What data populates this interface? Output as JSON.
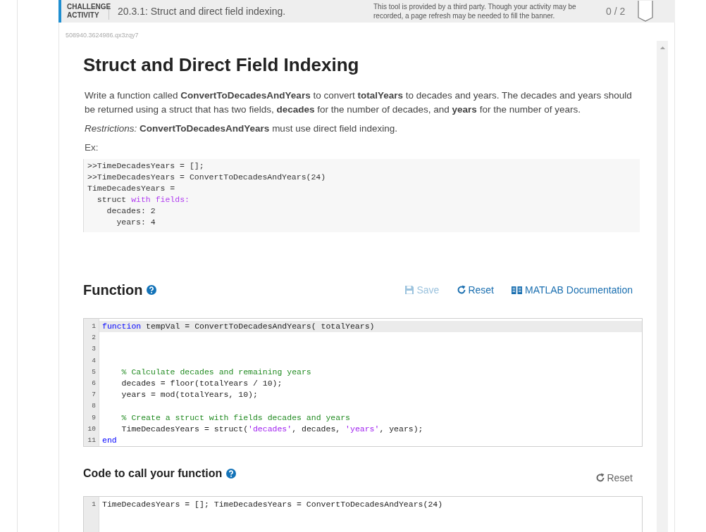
{
  "banner": {
    "label_lines": [
      "CHALLENGE",
      "ACTIVITY"
    ],
    "title": "20.3.1: Struct and direct field indexing.",
    "notice_lines": [
      "This tool is provided by a third party. Though your activity may be",
      "recorded, a page refresh may be needed to fill the banner."
    ],
    "score": "0 / 2"
  },
  "activity_id": "508940.3624986.qx3zqy7",
  "heading": "Struct and Direct Field Indexing",
  "description": "Write a function called **ConvertToDecadesAndYears** to convert **totalYears** to decades and years. The decades and years should be returned using a struct that has two fields, **decades** for the number of decades, and **years** for the number of years.",
  "restrictions": "*Restrictions:* **ConvertToDecadesAndYears** must use direct field indexing.",
  "example_label": "Ex:",
  "example_lines": [
    [
      {
        "kind": "plain",
        "text": ">>TimeDecadesYears = [];"
      }
    ],
    [
      {
        "kind": "plain",
        "text": ">>TimeDecadesYears = ConvertToDecadesAndYears(24)"
      }
    ],
    [
      {
        "kind": "plain",
        "text": "TimeDecadesYears = "
      }
    ],
    [
      {
        "kind": "plain",
        "text": "  struct "
      },
      {
        "kind": "keyword",
        "text": "with fields:"
      }
    ],
    [
      {
        "kind": "plain",
        "text": "    decades: 2"
      }
    ],
    [
      {
        "kind": "plain",
        "text": "      years: 4"
      }
    ]
  ],
  "function_section": {
    "title": "Function",
    "buttons": [
      {
        "kind": "save",
        "label": "Save",
        "disabled": true
      },
      {
        "kind": "reset",
        "label": "Reset",
        "disabled": false
      },
      {
        "kind": "docs",
        "label": "MATLAB Documentation",
        "disabled": false
      }
    ],
    "editor": {
      "lines": [
        {
          "number": "1",
          "active": true,
          "segments": [
            {
              "kind": "keyword",
              "text": "function"
            },
            {
              "kind": "plain",
              "text": " tempVal = ConvertToDecadesAndYears( totalYears)"
            }
          ]
        },
        {
          "number": "2",
          "active": false
        },
        {
          "number": "3",
          "active": false
        },
        {
          "number": "4",
          "active": false
        },
        {
          "number": "5",
          "active": false,
          "segments": [
            {
              "kind": "comment",
              "text": "    % Calculate decades and remaining years"
            }
          ]
        },
        {
          "number": "6",
          "active": false,
          "segments": [
            {
              "kind": "plain",
              "text": "    decades = floor(totalYears / 10);"
            }
          ]
        },
        {
          "number": "7",
          "active": false,
          "segments": [
            {
              "kind": "plain",
              "text": "    years = mod(totalYears, 10);"
            }
          ]
        },
        {
          "number": "8",
          "active": false
        },
        {
          "number": "9",
          "active": false,
          "segments": [
            {
              "kind": "comment",
              "text": "    % Create a struct with fields decades and years"
            }
          ]
        },
        {
          "number": "10",
          "active": false,
          "segments": [
            {
              "kind": "plain",
              "text": "    TimeDecadesYears = struct("
            },
            {
              "kind": "string",
              "text": "'decades'"
            },
            {
              "kind": "plain",
              "text": ", decades, "
            },
            {
              "kind": "string",
              "text": "'years'"
            },
            {
              "kind": "plain",
              "text": ", years);"
            }
          ]
        },
        {
          "number": "11",
          "active": false,
          "segments": [
            {
              "kind": "keyword",
              "text": "end"
            }
          ]
        }
      ]
    }
  },
  "call_section": {
    "title": "Code to call your function",
    "buttons": [
      {
        "kind": "reset",
        "label": "Reset",
        "disabled": true
      }
    ],
    "editor": {
      "lines": [
        {
          "number": "1",
          "active": false,
          "segments": [
            {
              "kind": "plain",
              "text": "TimeDecadesYears = []; TimeDecadesYears = ConvertToDecadesAndYears(24)"
            }
          ]
        }
      ]
    }
  }
}
